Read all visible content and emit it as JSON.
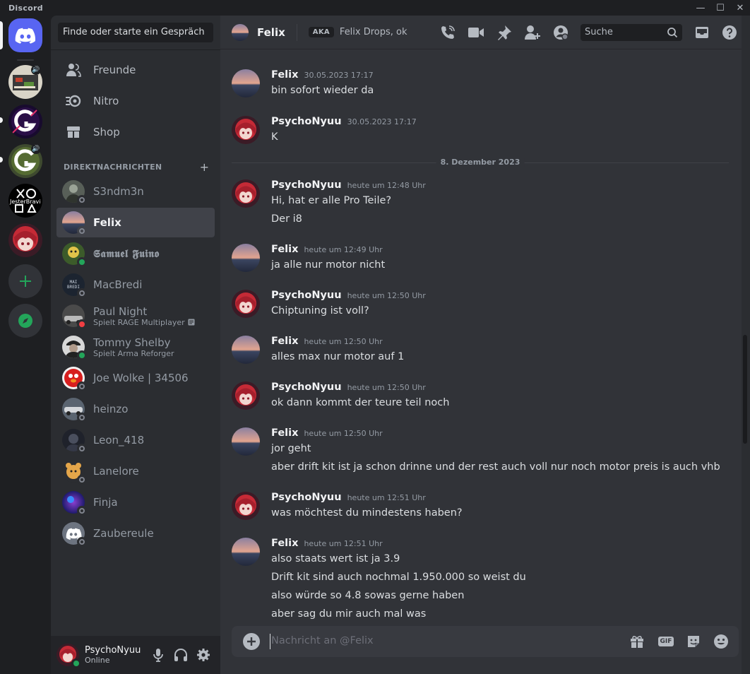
{
  "app": {
    "title": "Discord"
  },
  "window_controls": [
    "—",
    "☐",
    "✕"
  ],
  "servers": [
    {
      "name": "home",
      "icon": "discord-logo-icon"
    },
    {
      "name": "server-1"
    },
    {
      "name": "server-g-1"
    },
    {
      "name": "server-g-2"
    },
    {
      "name": "server-jesterbravi",
      "label": "JesterBravi"
    },
    {
      "name": "server-anime"
    },
    {
      "action": "add-server",
      "icon": "plus-icon"
    },
    {
      "action": "explore",
      "icon": "compass-icon"
    }
  ],
  "sidebar": {
    "search_placeholder": "Finde oder starte ein Gespräch",
    "nav": [
      {
        "label": "Freunde",
        "icon": "friends-icon"
      },
      {
        "label": "Nitro",
        "icon": "nitro-icon"
      },
      {
        "label": "Shop",
        "icon": "shop-icon"
      }
    ],
    "dm_header": "DIREKTNACHRICHTEN",
    "dm_add": "+",
    "dms": [
      {
        "name": "S3ndm3n",
        "status": "offline"
      },
      {
        "name": "Felix",
        "status": "offline",
        "active": true
      },
      {
        "name": "𝕾𝖆𝖒𝖚𝖊𝖑 𝕱𝖚𝖎𝖓𝖔",
        "status": "online"
      },
      {
        "name": "MacBredi",
        "status": "offline"
      },
      {
        "name": "Paul Night",
        "activity": "Spielt RAGE Multiplayer",
        "status": "dnd"
      },
      {
        "name": "Tommy Shelby",
        "activity": "Spielt Arma Reforger",
        "status": "online"
      },
      {
        "name": "Joe Wolke | 34506",
        "status": "offline"
      },
      {
        "name": "heinzo",
        "status": "offline"
      },
      {
        "name": "Leon_418",
        "status": "offline"
      },
      {
        "name": "Lanelore",
        "status": "offline"
      },
      {
        "name": "Finja",
        "status": "offline"
      },
      {
        "name": "Zaubereule",
        "status": "offline"
      }
    ]
  },
  "user_panel": {
    "name": "PsychoNyuu",
    "status": "Online"
  },
  "chat": {
    "recipient": "Felix",
    "aka_label": "AKA",
    "aka_names": "Felix Drops, ok",
    "search_placeholder": "Suche",
    "date_divider": "8. Dezember 2023",
    "messages": [
      {
        "author": "Felix",
        "time": "30.05.2023 17:17",
        "lines": [
          "bin sofort wieder da"
        ]
      },
      {
        "author": "PsychoNyuu",
        "time": "30.05.2023 17:17",
        "lines": [
          "K"
        ]
      },
      {
        "author": "PsychoNyuu",
        "time": "heute um 12:48 Uhr",
        "lines": [
          "Hi, hat er alle Pro Teile?",
          "Der i8"
        ]
      },
      {
        "author": "Felix",
        "time": "heute um 12:49 Uhr",
        "lines": [
          "ja alle nur motor nicht"
        ]
      },
      {
        "author": "PsychoNyuu",
        "time": "heute um 12:50 Uhr",
        "lines": [
          "Chiptuning ist voll?"
        ]
      },
      {
        "author": "Felix",
        "time": "heute um 12:50 Uhr",
        "lines": [
          "alles max nur motor auf 1"
        ]
      },
      {
        "author": "PsychoNyuu",
        "time": "heute um 12:50 Uhr",
        "lines": [
          "ok dann kommt der teure teil  noch"
        ]
      },
      {
        "author": "Felix",
        "time": "heute um 12:50 Uhr",
        "lines": [
          "jor geht",
          "aber drift kit ist ja schon drinne und der rest auch voll nur noch motor preis is auch vhb"
        ]
      },
      {
        "author": "PsychoNyuu",
        "time": "heute um 12:51 Uhr",
        "lines": [
          "was möchtest du mindestens haben?"
        ]
      },
      {
        "author": "Felix",
        "time": "heute um 12:51 Uhr",
        "lines": [
          "also staats wert ist ja 3.9",
          "Drift kit sind auch nochmal 1.950.000 so weist du",
          "also würde so 4.8 sowas gerne haben",
          "aber sag du mir auch mal was"
        ]
      }
    ],
    "composer_placeholder": "Nachricht an @Felix",
    "composer_gif": "GIF"
  },
  "colors": {
    "accent": "#5865f2",
    "online": "#23a55a",
    "dnd": "#f23f43",
    "offline": "#80848e"
  }
}
